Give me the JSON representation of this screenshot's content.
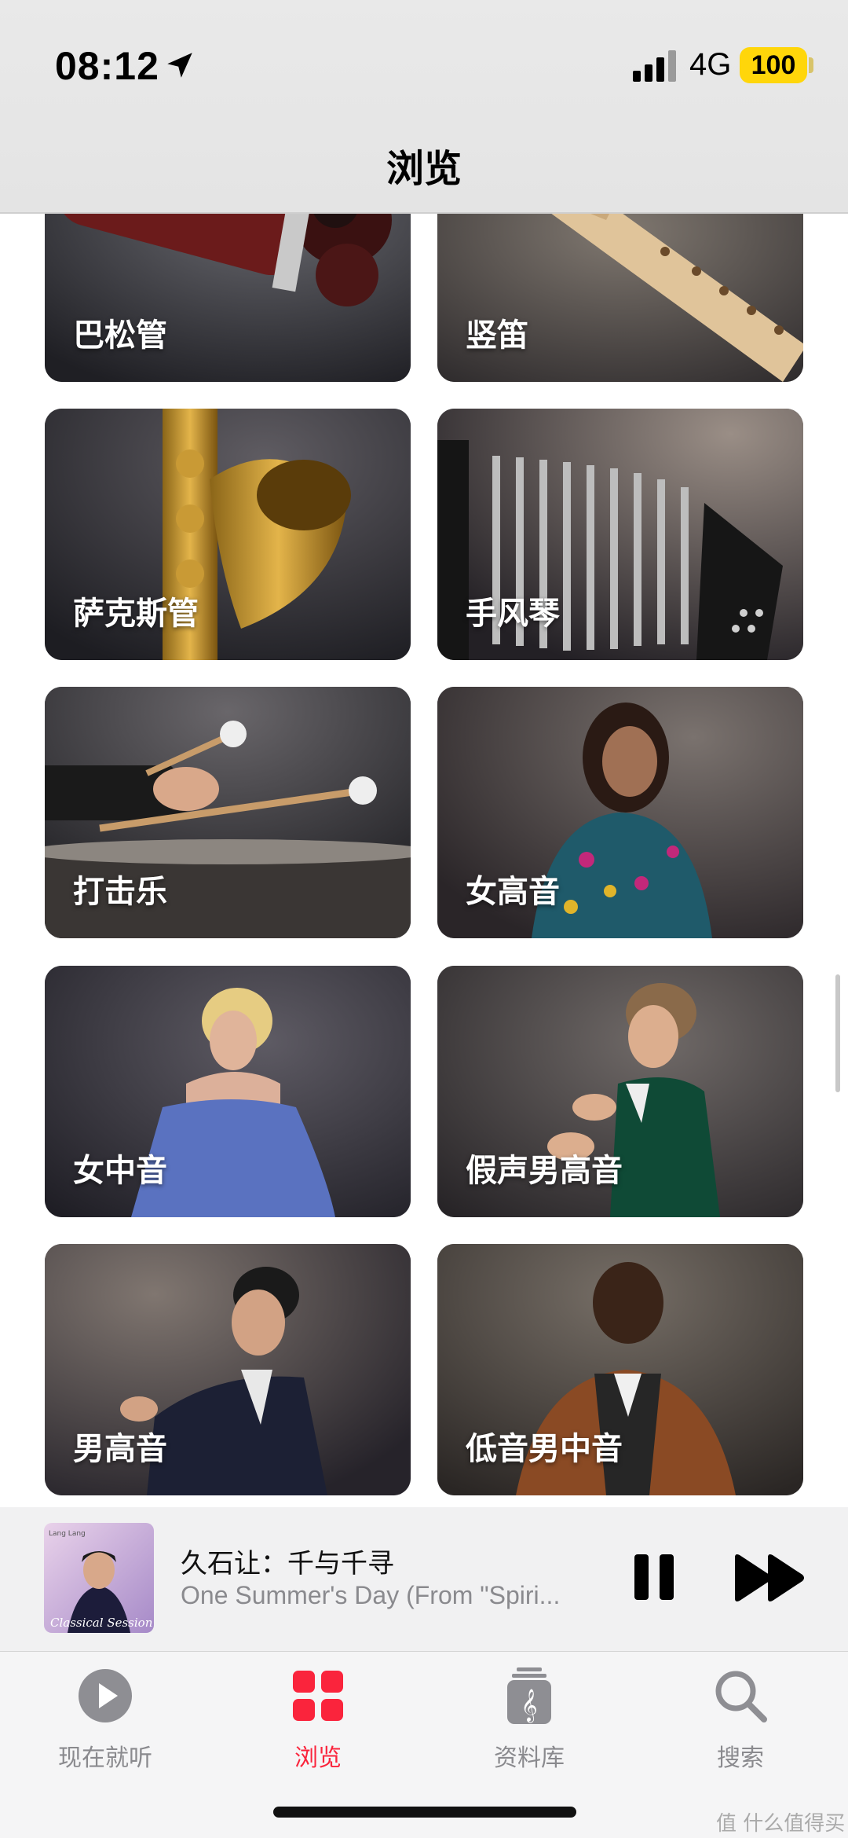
{
  "status": {
    "time": "08:12",
    "network": "4G",
    "battery": "100"
  },
  "header": {
    "title": "浏览"
  },
  "grid": [
    {
      "label": "巴松管",
      "theme": "bassoon"
    },
    {
      "label": "竖笛",
      "theme": "recorder"
    },
    {
      "label": "萨克斯管",
      "theme": "saxophone"
    },
    {
      "label": "手风琴",
      "theme": "accordion"
    },
    {
      "label": "打击乐",
      "theme": "percussion"
    },
    {
      "label": "女高音",
      "theme": "soprano"
    },
    {
      "label": "女中音",
      "theme": "mezzo"
    },
    {
      "label": "假声男高音",
      "theme": "countertenor"
    },
    {
      "label": "男高音",
      "theme": "tenor"
    },
    {
      "label": "低音男中音",
      "theme": "bassbaritone"
    }
  ],
  "player": {
    "album_artist": "Lang Lang",
    "album_name": "Classical Session",
    "title": "久石让：千与千寻",
    "subtitle": "One Summer's Day (From \"Spiri..."
  },
  "tabs": [
    {
      "label": "现在就听",
      "icon": "play-circle-icon",
      "active": false
    },
    {
      "label": "浏览",
      "icon": "grid-icon",
      "active": true
    },
    {
      "label": "资料库",
      "icon": "library-icon",
      "active": false
    },
    {
      "label": "搜索",
      "icon": "search-icon",
      "active": false
    }
  ],
  "watermark": "值 什么值得买",
  "colors": {
    "accent": "#fa243c",
    "battery": "#ffd60a"
  }
}
